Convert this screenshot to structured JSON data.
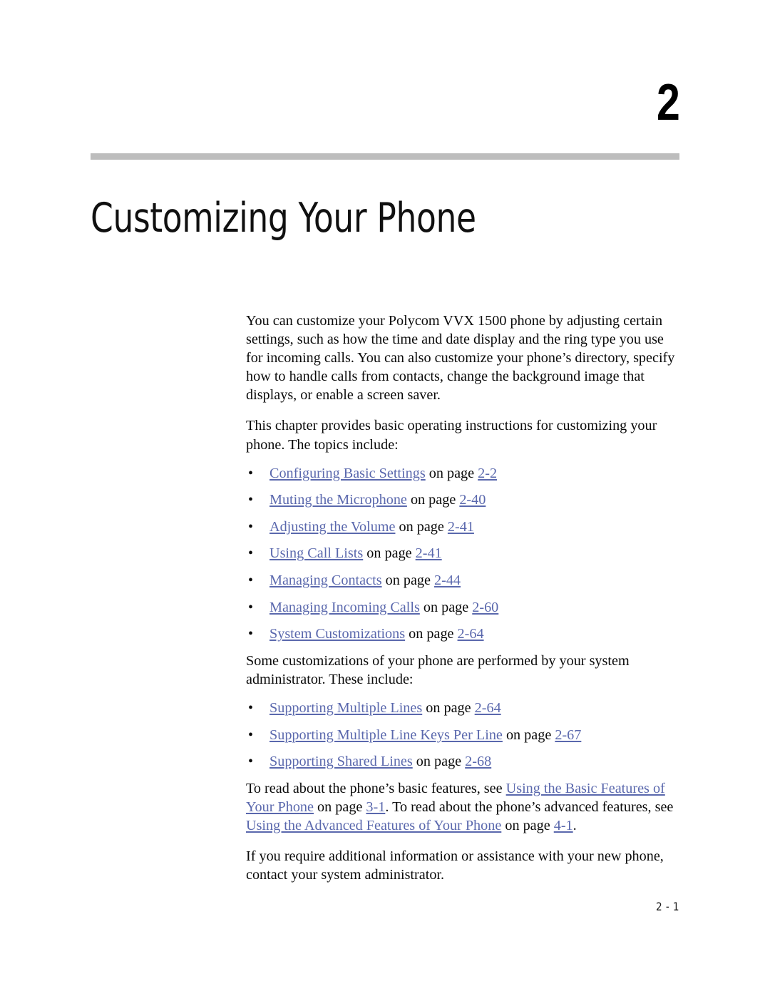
{
  "chapter": {
    "number": "2",
    "title": "Customizing Your Phone"
  },
  "colors": {
    "link": "#5a68ad",
    "rule": "#bdbdbd",
    "text": "#0a0a0a"
  },
  "intro": {
    "paragraph_1": "You can customize your Polycom VVX 1500 phone by adjusting certain settings, such as how the time and date display and the ring type you use for incoming calls. You can also customize your phone’s directory, specify how to handle calls from contacts, change the background image that displays, or enable a screen saver.",
    "paragraph_2": "This chapter provides basic operating instructions for customizing your phone. The topics include:"
  },
  "topics": [
    {
      "bullet": "•",
      "link": "Configuring Basic Settings",
      "on_page": " on page ",
      "page": "2-2"
    },
    {
      "bullet": "•",
      "link": "Muting the Microphone",
      "on_page": " on page ",
      "page": "2-40"
    },
    {
      "bullet": "•",
      "link": "Adjusting the Volume",
      "on_page": " on page ",
      "page": "2-41"
    },
    {
      "bullet": "•",
      "link": "Using Call Lists",
      "on_page": " on page ",
      "page": "2-41"
    },
    {
      "bullet": "•",
      "link": "Managing Contacts",
      "on_page": " on page ",
      "page": "2-44"
    },
    {
      "bullet": "•",
      "link": "Managing Incoming Calls",
      "on_page": " on page ",
      "page": "2-60"
    },
    {
      "bullet": "•",
      "link": "System Customizations",
      "on_page": " on page ",
      "page": "2-64"
    }
  ],
  "admin": {
    "paragraph": "Some customizations of your phone are performed by your system administrator. These include:"
  },
  "admin_topics": [
    {
      "bullet": "•",
      "link": "Supporting Multiple Lines",
      "on_page": " on page ",
      "page": "2-64"
    },
    {
      "bullet": "•",
      "link": "Supporting Multiple Line Keys Per Line",
      "on_page": " on page ",
      "page": "2-67"
    },
    {
      "bullet": "•",
      "link": "Supporting Shared Lines",
      "on_page": " on page ",
      "page": "2-68"
    }
  ],
  "closing": {
    "read_about_1": "To read about the phone’s basic features, see ",
    "link_basic": "Using the Basic Features of Your Phone",
    "on_page_1": " on page ",
    "page_basic": "3-1",
    "read_about_2": ". To read about the phone’s advanced features, see ",
    "link_advanced": "Using the Advanced Features of Your Phone",
    "on_page_2": " on page ",
    "page_advanced": "4-1",
    "period": ".",
    "assistance": "If you require additional information or assistance with your new phone, contact your system administrator."
  },
  "footer": {
    "folio": "2 - 1"
  }
}
